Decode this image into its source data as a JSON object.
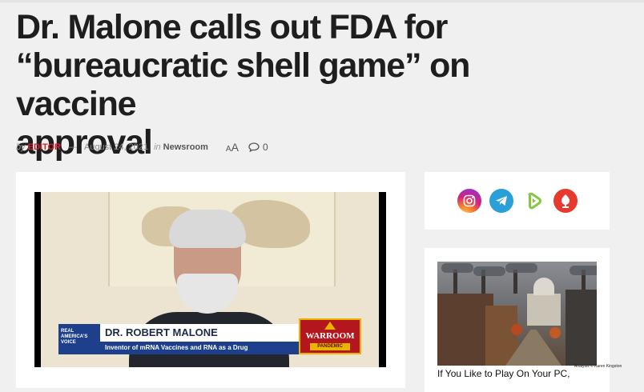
{
  "article": {
    "title_line1": "Dr. Malone calls out FDA for",
    "title_line2": "“bureaucratic shell game” on vaccine",
    "title_line3": "approval",
    "by_label": "by",
    "author": "EDITOR",
    "separator": "—",
    "date": "August 24, 2021",
    "in_label": "in",
    "category": "Newsroom",
    "font_small": "A",
    "font_large": "A",
    "comment_count": "0"
  },
  "video": {
    "channel_logo": "REAL AMERICA'S VOICE",
    "guest_name": "DR. ROBERT MALONE",
    "guest_desc": "Inventor of mRNA Vaccines and RNA as a Drug",
    "show_name": "WARROOM",
    "show_sub": "PANDEMIC"
  },
  "social": {
    "icons": [
      "instagram-icon",
      "telegram-icon",
      "rumble-icon",
      "gettr-icon"
    ]
  },
  "sidebar": {
    "promo_title": "If You Like to Play On Your PC,"
  },
  "watermark": "Analysis © Karen Kingston",
  "colors": {
    "accent": "#d2202f",
    "telegram": "#2b9fd8",
    "gettr": "#e53a2d",
    "rumble": "#85c742"
  }
}
